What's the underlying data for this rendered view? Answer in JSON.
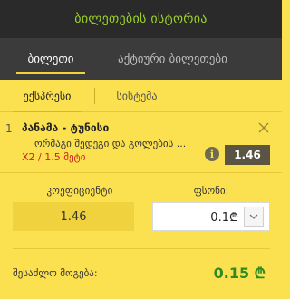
{
  "header": {
    "title": "ბილეთების ისტორია"
  },
  "main_tabs": [
    {
      "label": "ბილეთი",
      "active": true
    },
    {
      "label": "აქტიური ბილეთები",
      "active": false
    }
  ],
  "sub_tabs": [
    {
      "label": "ექსპრესი",
      "active": true
    },
    {
      "label": "სისტემა",
      "active": false
    }
  ],
  "bet": {
    "index": "1",
    "match": "პანამა - ტუნისი",
    "market": "ორმაგი შედეგი და გოლების ...",
    "selection": "X2 / 1.5 მეტი",
    "odds": "1.46"
  },
  "summary": {
    "coef_label": "კოეფიციენტი",
    "coef_value": "1.46",
    "stake_label": "ფსონი:",
    "stake_value": "0.1₾",
    "win_label": "შესაძლო მოგება:",
    "win_value": "0.15 ₾"
  },
  "colors": {
    "header_bg": "#2a2a2a",
    "header_text": "#9cd32b",
    "panel_bg": "#fbe14f",
    "win_green": "#2f8a1f",
    "selection_red": "#d0211b"
  }
}
